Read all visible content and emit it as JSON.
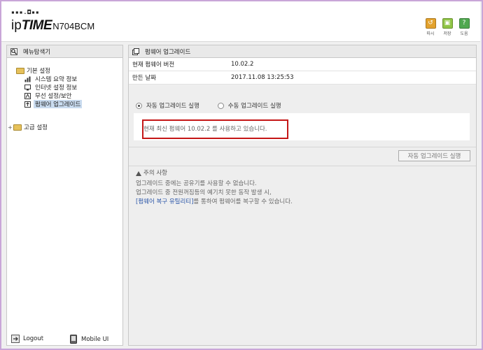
{
  "header": {
    "logo_top": "▪▪▪.◘▪▪",
    "brand_ip": "ip",
    "brand_time": "TIME",
    "model": "N704BCM",
    "buttons": [
      {
        "label": "따시",
        "icon": "refresh-icon",
        "color": "#e3a22d",
        "glyph": "↺"
      },
      {
        "label": "저장",
        "icon": "save-icon",
        "color": "#8fc445",
        "glyph": "▣"
      },
      {
        "label": "도움",
        "icon": "help-icon",
        "color": "#4fa84f",
        "glyph": "?"
      }
    ]
  },
  "sidebar": {
    "title": "메뉴탐색기",
    "basic": {
      "label": "기본 설정",
      "items": [
        {
          "label": "시스템 요약 정보",
          "icon": "chart-icon"
        },
        {
          "label": "인터넷 설정 정보",
          "icon": "monitor-icon"
        },
        {
          "label": "무선 설정/보안",
          "icon": "wireless-icon"
        },
        {
          "label": "펌웨어 업그레이드",
          "icon": "upgrade-icon",
          "selected": true
        }
      ]
    },
    "advanced": {
      "label": "고급 설정"
    },
    "footer": {
      "logout": "Logout",
      "mobile": "Mobile UI"
    }
  },
  "main": {
    "title": "펌웨어 업그레이드",
    "rows": [
      {
        "key": "현재 펌웨어 버전",
        "value": "10.02.2"
      },
      {
        "key": "만든 날짜",
        "value": "2017.11.08 13:25:53"
      }
    ],
    "radio_auto": "자동 업그레이드 실행",
    "radio_manual": "수동 업그레이드 실행",
    "status": "현재 최신 펌웨어 10.02.2 를 사용하고 있습니다.",
    "run_button": "자동 업그레이드 실행",
    "notice": {
      "title": "주의 사항",
      "line1": "업그레이드 중에는 공유기를 사용할 수 없습니다.",
      "line2": "업그레이드 중 전원꺼짐등의 예기치 못한 동작 발생 시,",
      "line3_link": "[펌웨어 복구 유틸리티]",
      "line3_rest": "를 통하여 펌웨어를 복구할 수 있습니다."
    }
  },
  "colors": {
    "accent_frame": "#c9a6d8",
    "highlight_red": "#c41616",
    "selected_bg": "#c9dbef"
  }
}
